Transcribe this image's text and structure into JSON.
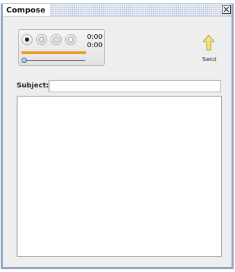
{
  "window": {
    "title": "Compose",
    "close_icon": "close-icon",
    "border_color": "#8fa3c6"
  },
  "recorder": {
    "buttons": [
      {
        "name": "record",
        "icon": "record-icon"
      },
      {
        "name": "play",
        "icon": "play-icon"
      },
      {
        "name": "pause",
        "icon": "pause-icon"
      },
      {
        "name": "stop",
        "icon": "stop-icon"
      }
    ],
    "elapsed_time": "0:00",
    "total_time": "0:00",
    "progress_fraction": 1.0,
    "progress_color": "#ee9a23",
    "position_fraction": 0.0
  },
  "send": {
    "label": "Send",
    "icon": "up-arrow-icon",
    "icon_color": "#f5e27a"
  },
  "subject": {
    "label": "Subject:",
    "value": "",
    "placeholder": ""
  },
  "message_body": {
    "value": ""
  }
}
